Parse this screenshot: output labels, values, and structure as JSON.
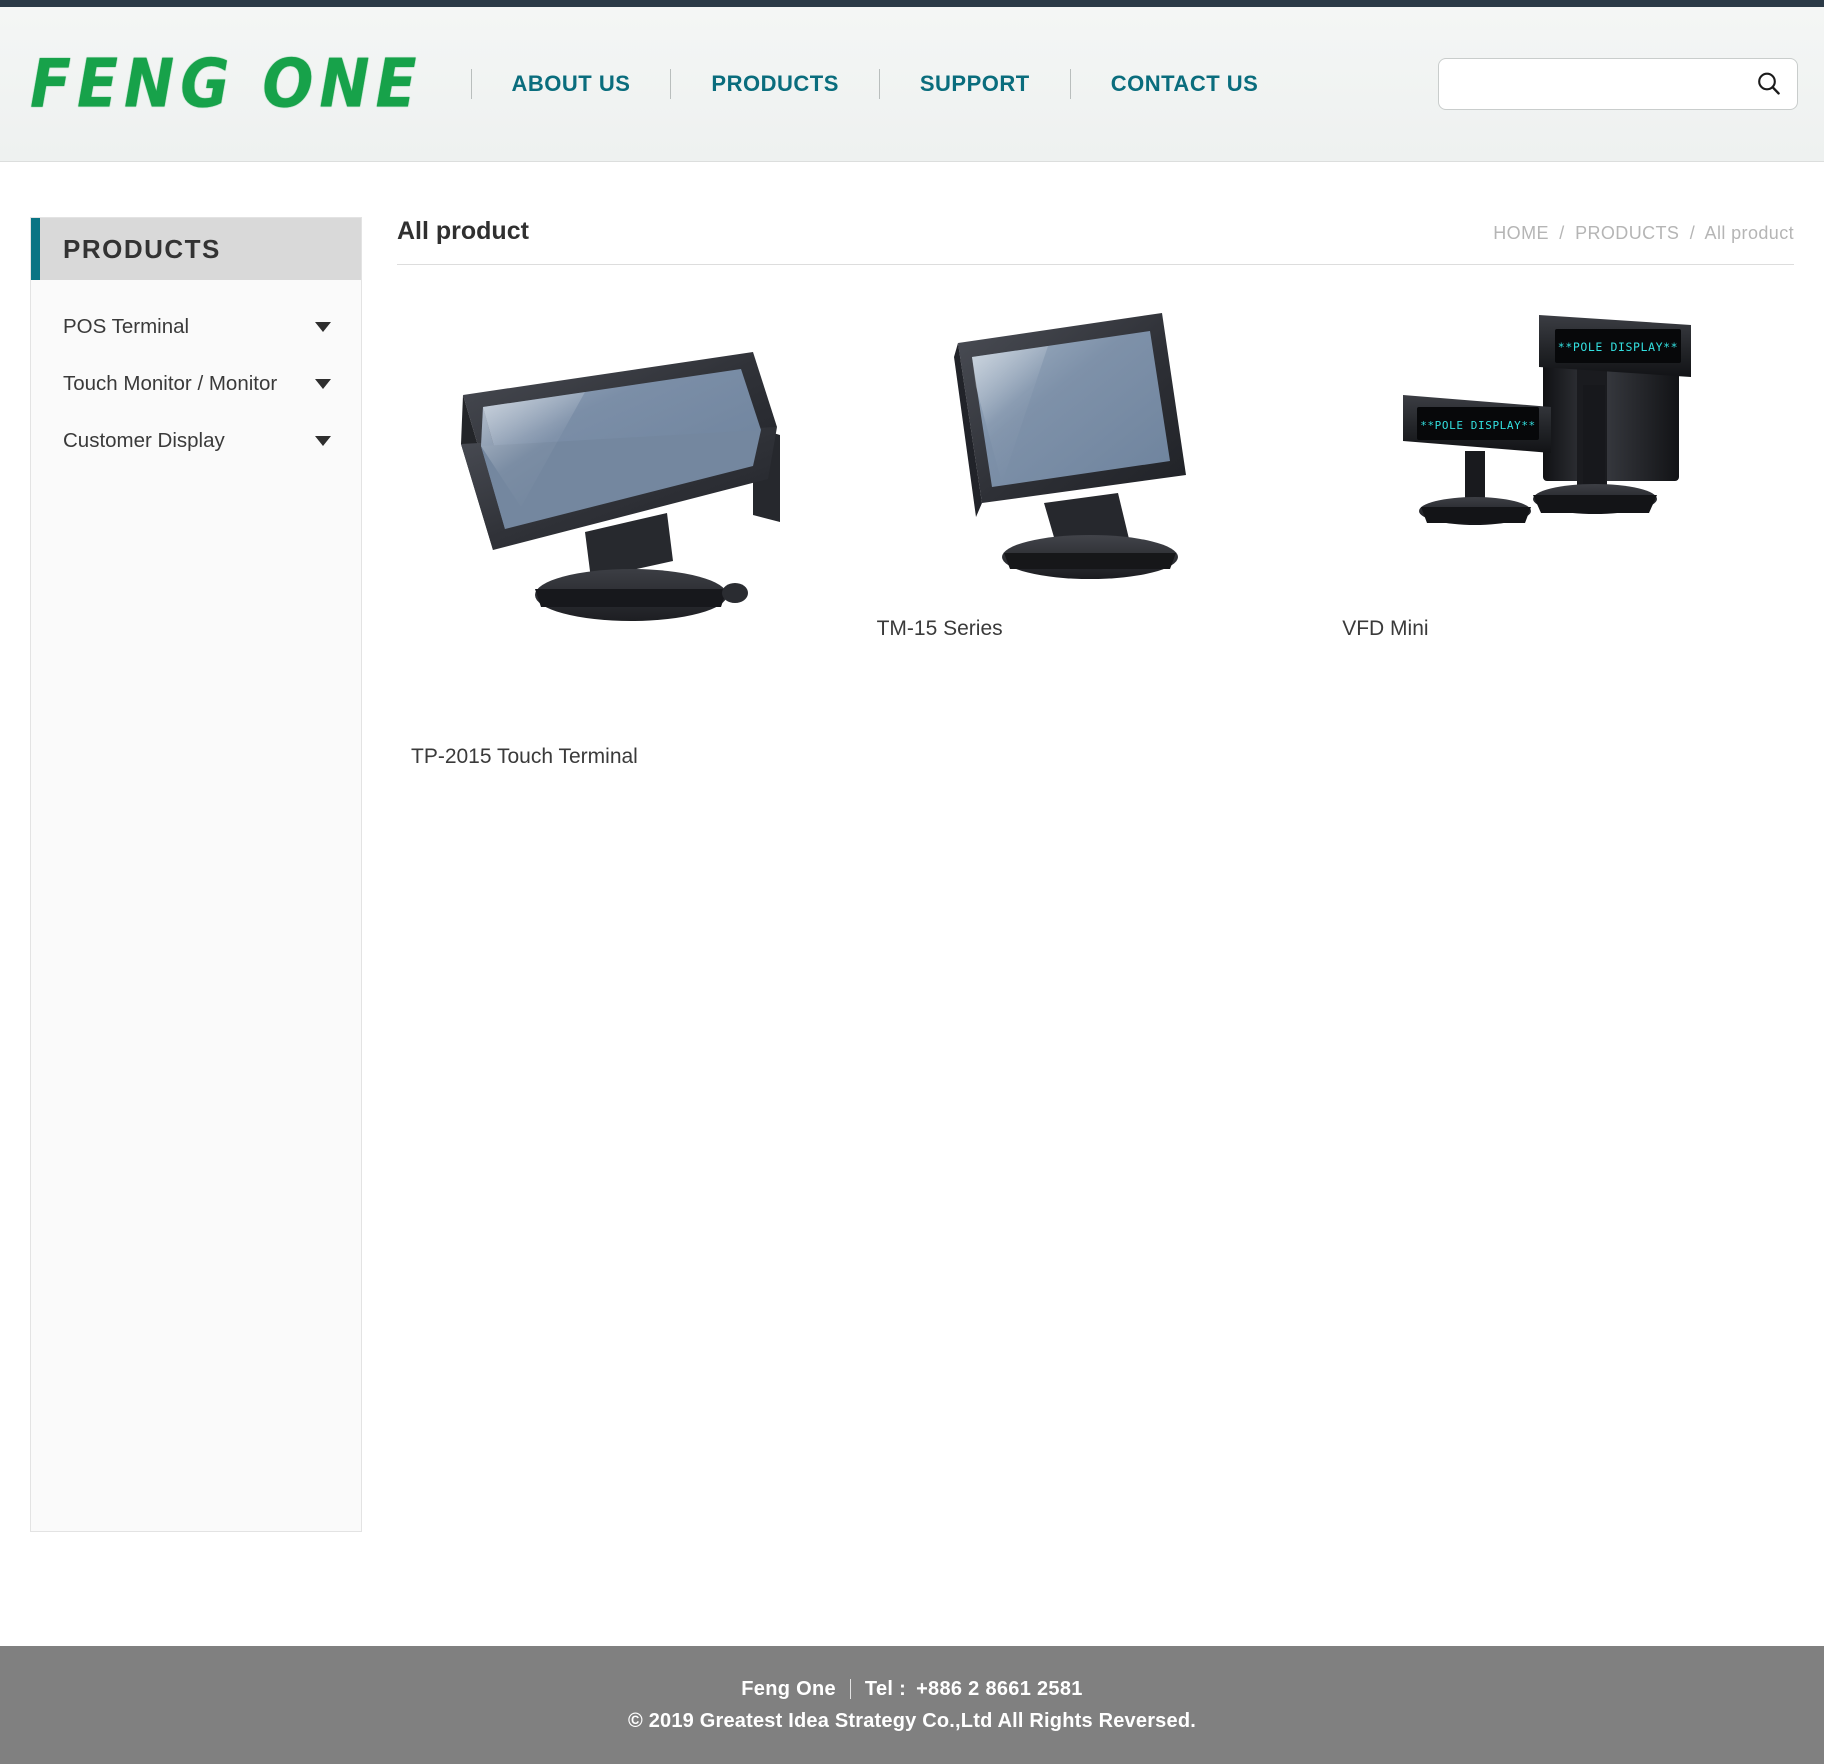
{
  "header": {
    "logo_text": "FENG ONE",
    "logo_color": "#17a24a",
    "nav_color": "#0a6d7d",
    "nav": [
      {
        "label": "ABOUT US"
      },
      {
        "label": "PRODUCTS"
      },
      {
        "label": "SUPPORT"
      },
      {
        "label": "CONTACT US"
      }
    ],
    "search": {
      "value": "",
      "placeholder": "",
      "icon": "search-icon"
    }
  },
  "sidebar": {
    "title": "PRODUCTS",
    "accent_color": "#0a7484",
    "items": [
      {
        "label": "POS Terminal",
        "icon": "chevron-down-icon"
      },
      {
        "label": "Touch Monitor / Monitor",
        "icon": "chevron-down-icon"
      },
      {
        "label": "Customer Display",
        "icon": "chevron-down-icon"
      }
    ]
  },
  "main": {
    "page_title": "All product",
    "breadcrumb": {
      "items": [
        "HOME",
        "PRODUCTS",
        "All product"
      ],
      "separator": "/"
    },
    "products": [
      {
        "name": "TP-2015 Touch Terminal",
        "image": "pos-terminal-photo"
      },
      {
        "name": "TM-15 Series",
        "image": "touch-monitor-photo"
      },
      {
        "name": "VFD Mini",
        "image": "pole-display-photo"
      }
    ],
    "pole_display_text": "**POLE DISPLAY**"
  },
  "footer": {
    "company": "Feng One",
    "tel_label": "Tel :",
    "tel_value": "+886 2 8661 2581",
    "copyright": "© 2019 Greatest Idea Strategy Co.,Ltd All Rights Reversed.",
    "background": "#808080"
  }
}
